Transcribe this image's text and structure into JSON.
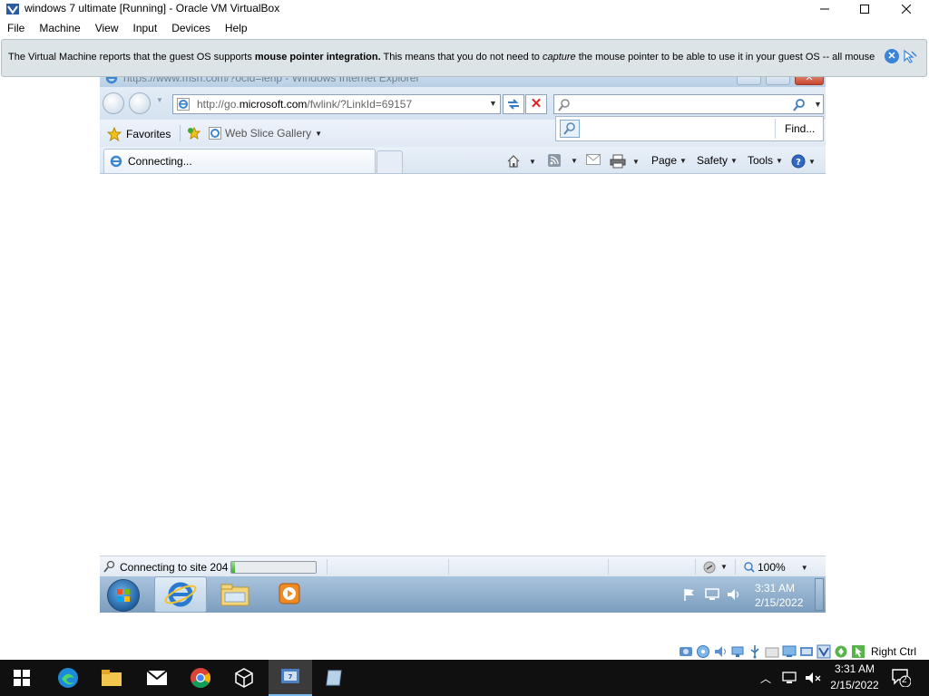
{
  "vbox": {
    "title": "windows 7 ultimate [Running] - Oracle VM VirtualBox",
    "menu": [
      "File",
      "Machine",
      "View",
      "Input",
      "Devices",
      "Help"
    ],
    "notice": {
      "part1": "The Virtual Machine reports that the guest OS supports ",
      "bold": "mouse pointer integration.",
      "part2": " This means that you do not need to ",
      "italic": "capture",
      "part3": " the mouse pointer to be able to use it in your guest OS -- all mouse"
    },
    "host_key_label": "Right Ctrl"
  },
  "ie": {
    "title": "https://www.msn.com/?ocid=iehp - Windows Internet Explorer",
    "address_prefix": "http://go.",
    "address_domain": "microsoft.com",
    "address_suffix": "/fwlink/?LinkId=69157",
    "search_value": "",
    "find_label": "Find...",
    "favorites_label": "Favorites",
    "web_slice_label": "Web Slice Gallery",
    "tab_label": "Connecting...",
    "commands": {
      "page": "Page",
      "safety": "Safety",
      "tools": "Tools"
    },
    "status_text": "Connecting to site 204",
    "progress_fraction": 0.04,
    "zoom": "100%"
  },
  "guest_taskbar": {
    "time": "3:31 AM",
    "date": "2/15/2022"
  },
  "host_taskbar": {
    "time": "3:31 AM",
    "date": "2/15/2022",
    "notification_count": "2"
  },
  "colors": {
    "accent": "#3a83d6",
    "host_taskbar": "#101010",
    "guest_taskbar": "#8fb0d0"
  }
}
